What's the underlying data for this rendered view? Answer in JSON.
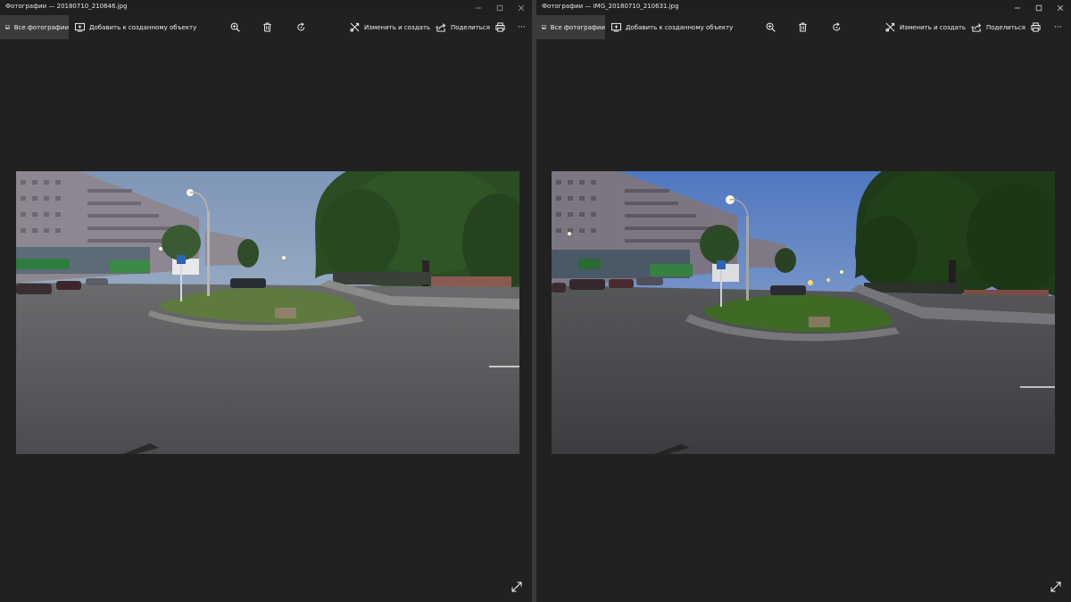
{
  "windows": [
    {
      "title": "Фотографии — 20180710_210646.jpg",
      "toolbar": {
        "all_photos": "Все фотографии",
        "add_to_creation": "Добавить к созданному объекту",
        "edit_create": "Изменить и создать",
        "share": "Поделиться",
        "more": "···"
      }
    },
    {
      "title": "Фотографии — IMG_20180710_210631.jpg",
      "toolbar": {
        "all_photos": "Все фотографии",
        "add_to_creation": "Добавить к созданному объекту",
        "edit_create": "Изменить и создать",
        "share": "Поделиться",
        "more": "···"
      }
    }
  ],
  "icons": [
    "image-icon",
    "add-to-creation-icon",
    "zoom-icon",
    "delete-icon",
    "rotate-icon",
    "edit-create-icon",
    "chevron-down-icon",
    "share-icon",
    "print-icon",
    "more-icon",
    "minimize-icon",
    "maximize-icon",
    "close-icon",
    "fullscreen-icon"
  ],
  "colors": {
    "window_bg": "#212121",
    "toolbar_active": "#3b3b3b",
    "sky_left": "#8fa6c6",
    "sky_right": "#5f86c7",
    "road": "#4e4f52",
    "tree": "#2a4a22"
  }
}
